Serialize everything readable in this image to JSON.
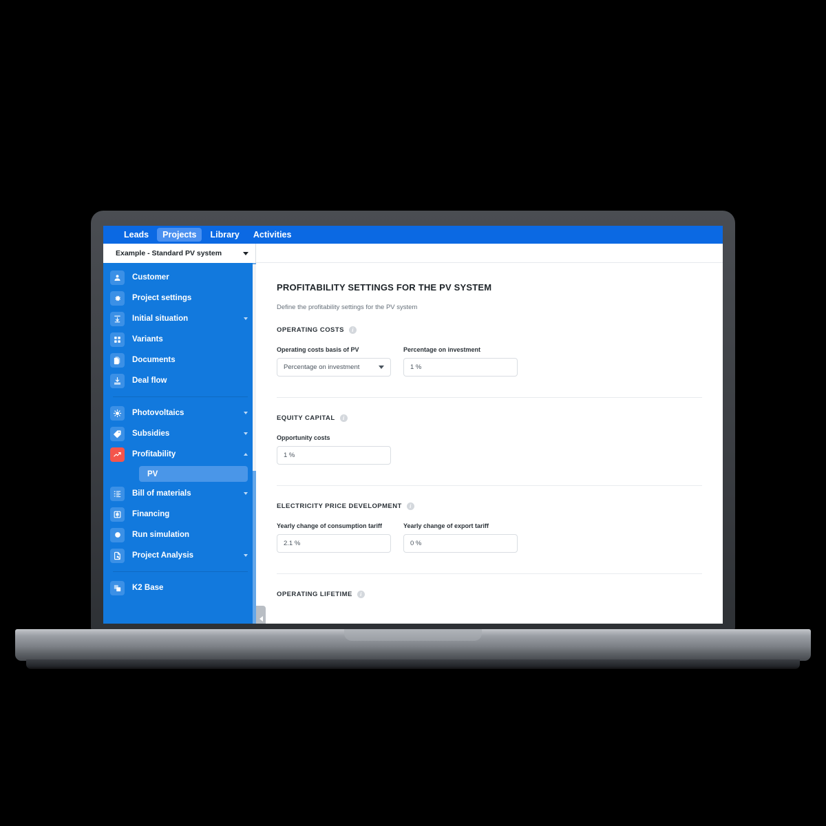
{
  "topbar": {
    "tabs": [
      {
        "label": "Leads",
        "active": false
      },
      {
        "label": "Projects",
        "active": true
      },
      {
        "label": "Library",
        "active": false
      },
      {
        "label": "Activities",
        "active": false
      }
    ]
  },
  "project_selector": {
    "value": "Example - Standard PV system"
  },
  "sidebar": {
    "group1": [
      {
        "label": "Customer",
        "icon": "person-icon",
        "caret": "none"
      },
      {
        "label": "Project settings",
        "icon": "gear-icon",
        "caret": "none"
      },
      {
        "label": "Initial situation",
        "icon": "import-icon",
        "caret": "down"
      },
      {
        "label": "Variants",
        "icon": "grid-icon",
        "caret": "none"
      },
      {
        "label": "Documents",
        "icon": "documents-icon",
        "caret": "none"
      },
      {
        "label": "Deal flow",
        "icon": "download-icon",
        "caret": "none"
      }
    ],
    "group2": [
      {
        "label": "Photovoltaics",
        "icon": "sun-icon",
        "caret": "down"
      },
      {
        "label": "Subsidies",
        "icon": "tag-icon",
        "caret": "down"
      },
      {
        "label": "Profitability",
        "icon": "trending-up-icon",
        "caret": "up",
        "accent": true
      },
      {
        "label": "Bill of materials",
        "icon": "list-icon",
        "caret": "down"
      },
      {
        "label": "Financing",
        "icon": "bank-icon",
        "caret": "none"
      },
      {
        "label": "Run simulation",
        "icon": "record-circle-icon",
        "caret": "none"
      },
      {
        "label": "Project Analysis",
        "icon": "analysis-icon",
        "caret": "down"
      }
    ],
    "profitability_sub": [
      {
        "label": "PV",
        "active": true
      }
    ],
    "group3": [
      {
        "label": "K2 Base",
        "icon": "layers-icon",
        "caret": "none"
      }
    ]
  },
  "collapse_handle": {
    "icon": "chevron-left-icon"
  },
  "content": {
    "title": "PROFITABILITY SETTINGS FOR THE PV SYSTEM",
    "subtitle": "Define the profitability settings for the PV system",
    "sections": [
      {
        "heading": "OPERATING COSTS",
        "fields": [
          {
            "label": "Operating costs basis of PV",
            "value": "Percentage on investment",
            "type": "select"
          },
          {
            "label": "Percentage on investment",
            "value": "1 %",
            "type": "input"
          }
        ]
      },
      {
        "heading": "EQUITY CAPITAL",
        "fields": [
          {
            "label": "Opportunity costs",
            "value": "1 %",
            "type": "input"
          }
        ]
      },
      {
        "heading": "ELECTRICITY PRICE DEVELOPMENT",
        "fields": [
          {
            "label": "Yearly change of consumption tariff",
            "value": "2.1 %",
            "type": "input"
          },
          {
            "label": "Yearly change of export tariff",
            "value": "0 %",
            "type": "input"
          }
        ]
      },
      {
        "heading": "OPERATING LIFETIME",
        "fields": []
      }
    ]
  },
  "colors": {
    "brand_blue": "#0b69e3",
    "sidebar_blue": "#1279dd",
    "accent_red": "#f4554c",
    "icon_tile_blue": "#3b90e6"
  }
}
